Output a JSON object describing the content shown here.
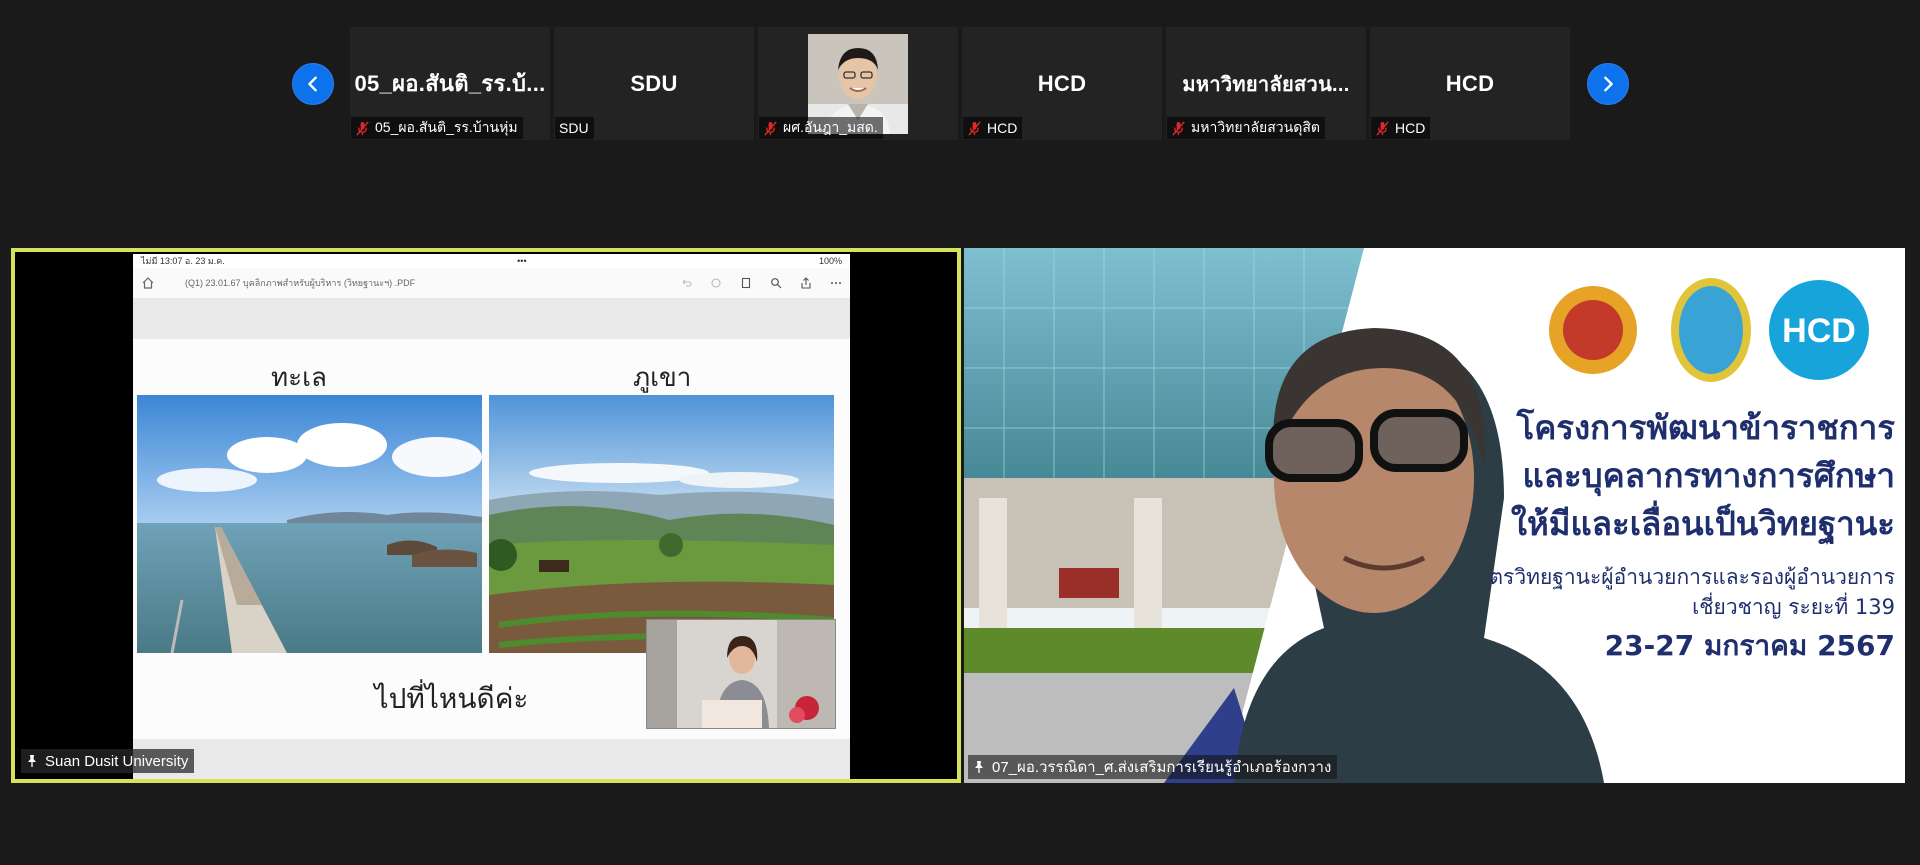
{
  "strip": {
    "prev_label": "",
    "next_label": "",
    "participants": [
      {
        "display": "05_ผอ.สันติ_รร.บ้...",
        "label": "05_ผอ.สันติ_รร.บ้านหุ่ม",
        "muted": true
      },
      {
        "display": "SDU",
        "label": "SDU",
        "muted": false
      },
      {
        "display": "",
        "label": "ผศ.อันฎา_มสด.",
        "muted": true,
        "has_video": true
      },
      {
        "display": "HCD",
        "label": "HCD",
        "muted": true
      },
      {
        "display": "มหาวิทยาลัยสวน...",
        "label": "มหาวิทยาลัยสวนดุสิต",
        "muted": true
      },
      {
        "display": "HCD",
        "label": "HCD",
        "muted": true
      }
    ]
  },
  "main_left": {
    "name": "Suan Dusit University",
    "status_bar": {
      "left": "ไม่มี 13:07  อ. 23 ม.ค.",
      "center": "•••",
      "right": "100%"
    },
    "doc_title": "(Q1) 23.01.67 บุคลิกภาพสำหรับผู้บริหาร (วิทยฐานะฯ) .PDF",
    "slide": {
      "left_heading": "ทะเล",
      "right_heading": "ภูเขา",
      "bottom_text": "ไปที่ไหนดีค่ะ"
    }
  },
  "main_right": {
    "name": "07_ผอ.วรรณิดา_ศ.ส่งเสริมการเรียนรู้อำเภอร้องกวาง",
    "banner": {
      "line1": "โครงการพัฒนาข้าราชการ",
      "line2": "และบุคลากรทางการศึกษา",
      "line3": "ให้มีและเลื่อนเป็นวิทยฐานะ",
      "line4": "ตรวิทยฐานะผู้อำนวยการและรองผู้อำนวยการ",
      "line5": "เชี่ยวชาญ ระยะที่ 139",
      "line6": "23-27 มกราคม 2567",
      "logo3_text": "HCD"
    }
  },
  "colors": {
    "active_border": "#d5e25a",
    "nav_blue": "#0e72ed",
    "muted_red": "#e02828",
    "banner_navy": "#1f2f6d"
  }
}
